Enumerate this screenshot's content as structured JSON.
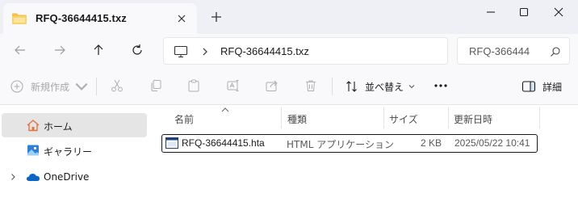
{
  "window": {
    "tab_title": "RFQ-36644415.txz",
    "tab_close_icon": "close-icon",
    "new_tab_icon": "plus-icon",
    "controls": [
      "minimize-icon",
      "maximize-icon",
      "close-icon"
    ]
  },
  "navigation": {
    "back_icon": "arrow-left-icon",
    "forward_icon": "arrow-right-icon",
    "up_icon": "arrow-up-icon",
    "refresh_icon": "refresh-icon"
  },
  "address_bar": {
    "location_icon": "this-pc-icon",
    "path": "RFQ-36644415.txz"
  },
  "search": {
    "text": "RFQ-366444",
    "icon": "search-icon"
  },
  "command_bar": {
    "new_label": "新規作成",
    "sort_label": "並べ替え",
    "details_label": "詳細",
    "disabled_icons": [
      "cut-icon",
      "copy-icon",
      "paste-icon",
      "rename-icon",
      "share-icon",
      "delete-icon"
    ],
    "more_icon": "more-icon"
  },
  "sidebar": {
    "items": [
      {
        "label": "ホーム",
        "icon": "home-icon",
        "selected": true
      },
      {
        "label": "ギャラリー",
        "icon": "gallery-icon",
        "selected": false
      },
      {
        "label": "OneDrive",
        "icon": "onedrive-icon",
        "selected": false,
        "expandable": true
      }
    ]
  },
  "file_list": {
    "columns": [
      "名前",
      "種類",
      "サイズ",
      "更新日時"
    ],
    "sorted_by": "名前",
    "rows": [
      {
        "name": "RFQ-36644415.hta",
        "type": "HTML アプリケーション",
        "size": "2 KB",
        "modified": "2025/05/22 10:41",
        "icon": "hta-file-icon",
        "selected": true
      }
    ]
  },
  "colors": {
    "titlebar_bg": "#eef0f6",
    "toolbar_bg": "#f9f9fb",
    "selected_nav_bg": "#e5e5e5",
    "home_icon": "#e8713b",
    "onedrive_icon": "#0a64c8",
    "disabled_text": "#a8a8a8"
  }
}
